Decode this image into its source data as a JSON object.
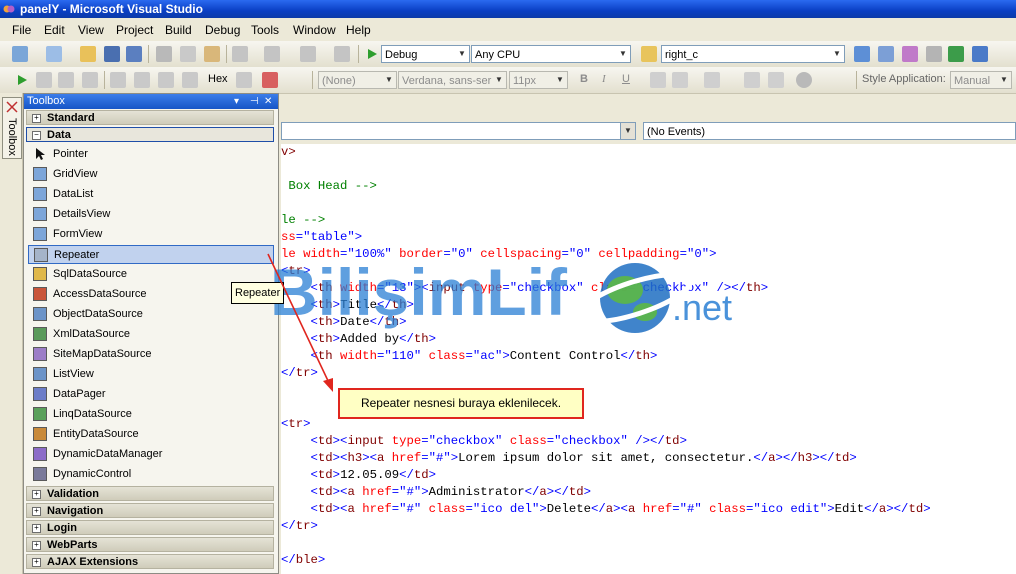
{
  "window": {
    "title": "panelY - Microsoft Visual Studio"
  },
  "menu": {
    "items": [
      "File",
      "Edit",
      "View",
      "Project",
      "Build",
      "Debug",
      "Tools",
      "Window",
      "Help"
    ]
  },
  "toolbar1": {
    "config": "Debug",
    "platform": "Any CPU",
    "find": "right_c"
  },
  "toolbar2": {
    "hex_label": "Hex",
    "style_target": "(None)",
    "font_name": "Verdana, sans-ser",
    "font_size": "11px",
    "bold": "B",
    "italic": "I",
    "underline": "U",
    "style_app_label": "Style Application:",
    "style_app_value": "Manual"
  },
  "side_tab": {
    "label": "Toolbox"
  },
  "toolbox": {
    "title": "Toolbox",
    "categories_top": [
      {
        "label": "Standard",
        "sign": "+"
      },
      {
        "label": "Data",
        "sign": "−"
      }
    ],
    "data_items": [
      "Pointer",
      "GridView",
      "DataList",
      "DetailsView",
      "FormView",
      "Repeater",
      "SqlDataSource",
      "AccessDataSource",
      "ObjectDataSource",
      "XmlDataSource",
      "SiteMapDataSource",
      "ListView",
      "DataPager",
      "LinqDataSource",
      "EntityDataSource",
      "DynamicDataManager",
      "DynamicControl"
    ],
    "categories_bottom": [
      {
        "label": "Validation",
        "sign": "+"
      },
      {
        "label": "Navigation",
        "sign": "+"
      },
      {
        "label": "Login",
        "sign": "+"
      },
      {
        "label": "WebParts",
        "sign": "+"
      },
      {
        "label": "AJAX Extensions",
        "sign": "+"
      }
    ]
  },
  "editor": {
    "events_dropdown": "(No Events)"
  },
  "tooltip": {
    "text": "Repeater"
  },
  "callout": {
    "text": "Repeater nesnesi buraya eklenilecek."
  },
  "watermark": {
    "text_main": "BilişimLif",
    "text_suffix": ".net"
  },
  "code_lines": [
    [
      [
        "cm",
        "v>"
      ]
    ],
    [],
    [
      [
        "cg",
        " Box Head -->"
      ]
    ],
    [],
    [
      [
        "cg",
        "le -->"
      ]
    ],
    [
      [
        "cr",
        "ss"
      ],
      [
        "cb",
        "=\"table\">"
      ]
    ],
    [
      [
        "cr",
        "le width"
      ],
      [
        "cb",
        "=\"100%\" "
      ],
      [
        "cr",
        "border"
      ],
      [
        "cb",
        "=\"0\" "
      ],
      [
        "cr",
        "cellspacing"
      ],
      [
        "cb",
        "=\"0\" "
      ],
      [
        "cr",
        "cellpadding"
      ],
      [
        "cb",
        "=\"0\">"
      ]
    ],
    [
      [
        "cb",
        "<"
      ],
      [
        "cm",
        "tr"
      ],
      [
        "cb",
        ">"
      ]
    ],
    [
      [
        "cb",
        "    <"
      ],
      [
        "cm",
        "th "
      ],
      [
        "cr",
        "width"
      ],
      [
        "cb",
        "=\"13\"><"
      ],
      [
        "cm",
        "input "
      ],
      [
        "cr",
        "type"
      ],
      [
        "cb",
        "=\"checkbox\" "
      ],
      [
        "cr",
        "class"
      ],
      [
        "cb",
        "=\"checkbox\" /></"
      ],
      [
        "cm",
        "th"
      ],
      [
        "cb",
        ">"
      ]
    ],
    [
      [
        "cb",
        "    <"
      ],
      [
        "cm",
        "th"
      ],
      [
        "cb",
        ">"
      ],
      [
        "k",
        "Title"
      ],
      [
        "cb",
        "</"
      ],
      [
        "cm",
        "th"
      ],
      [
        "cb",
        ">"
      ]
    ],
    [
      [
        "cb",
        "    <"
      ],
      [
        "cm",
        "th"
      ],
      [
        "cb",
        ">"
      ],
      [
        "k",
        "Date"
      ],
      [
        "cb",
        "</"
      ],
      [
        "cm",
        "th"
      ],
      [
        "cb",
        ">"
      ]
    ],
    [
      [
        "cb",
        "    <"
      ],
      [
        "cm",
        "th"
      ],
      [
        "cb",
        ">"
      ],
      [
        "k",
        "Added by"
      ],
      [
        "cb",
        "</"
      ],
      [
        "cm",
        "th"
      ],
      [
        "cb",
        ">"
      ]
    ],
    [
      [
        "cb",
        "    <"
      ],
      [
        "cm",
        "th "
      ],
      [
        "cr",
        "width"
      ],
      [
        "cb",
        "=\"110\" "
      ],
      [
        "cr",
        "class"
      ],
      [
        "cb",
        "=\"ac\">"
      ],
      [
        "k",
        "Content Control"
      ],
      [
        "cb",
        "</"
      ],
      [
        "cm",
        "th"
      ],
      [
        "cb",
        ">"
      ]
    ],
    [
      [
        "cb",
        "</"
      ],
      [
        "cm",
        "tr"
      ],
      [
        "cb",
        ">"
      ]
    ],
    [],
    [],
    [
      [
        "cb",
        "<"
      ],
      [
        "cm",
        "tr"
      ],
      [
        "cb",
        ">"
      ]
    ],
    [
      [
        "cb",
        "    <"
      ],
      [
        "cm",
        "td"
      ],
      [
        "cb",
        "><"
      ],
      [
        "cm",
        "input "
      ],
      [
        "cr",
        "type"
      ],
      [
        "cb",
        "=\"checkbox\" "
      ],
      [
        "cr",
        "class"
      ],
      [
        "cb",
        "=\"checkbox\" /></"
      ],
      [
        "cm",
        "td"
      ],
      [
        "cb",
        ">"
      ]
    ],
    [
      [
        "cb",
        "    <"
      ],
      [
        "cm",
        "td"
      ],
      [
        "cb",
        "><"
      ],
      [
        "cm",
        "h3"
      ],
      [
        "cb",
        "><"
      ],
      [
        "cm",
        "a "
      ],
      [
        "cr",
        "href"
      ],
      [
        "cb",
        "=\"#\">"
      ],
      [
        "k",
        "Lorem ipsum dolor sit amet, consectetur."
      ],
      [
        "cb",
        "</"
      ],
      [
        "cm",
        "a"
      ],
      [
        "cb",
        "></"
      ],
      [
        "cm",
        "h3"
      ],
      [
        "cb",
        "></"
      ],
      [
        "cm",
        "td"
      ],
      [
        "cb",
        ">"
      ]
    ],
    [
      [
        "cb",
        "    <"
      ],
      [
        "cm",
        "td"
      ],
      [
        "cb",
        ">"
      ],
      [
        "k",
        "12.05.09"
      ],
      [
        "cb",
        "</"
      ],
      [
        "cm",
        "td"
      ],
      [
        "cb",
        ">"
      ]
    ],
    [
      [
        "cb",
        "    <"
      ],
      [
        "cm",
        "td"
      ],
      [
        "cb",
        "><"
      ],
      [
        "cm",
        "a "
      ],
      [
        "cr",
        "href"
      ],
      [
        "cb",
        "=\"#\">"
      ],
      [
        "k",
        "Administrator"
      ],
      [
        "cb",
        "</"
      ],
      [
        "cm",
        "a"
      ],
      [
        "cb",
        "></"
      ],
      [
        "cm",
        "td"
      ],
      [
        "cb",
        ">"
      ]
    ],
    [
      [
        "cb",
        "    <"
      ],
      [
        "cm",
        "td"
      ],
      [
        "cb",
        "><"
      ],
      [
        "cm",
        "a "
      ],
      [
        "cr",
        "href"
      ],
      [
        "cb",
        "=\"#\" "
      ],
      [
        "cr",
        "class"
      ],
      [
        "cb",
        "=\"ico del\">"
      ],
      [
        "k",
        "Delete"
      ],
      [
        "cb",
        "</"
      ],
      [
        "cm",
        "a"
      ],
      [
        "cb",
        "><"
      ],
      [
        "cm",
        "a "
      ],
      [
        "cr",
        "href"
      ],
      [
        "cb",
        "=\"#\" "
      ],
      [
        "cr",
        "class"
      ],
      [
        "cb",
        "=\"ico edit\">"
      ],
      [
        "k",
        "Edit"
      ],
      [
        "cb",
        "</"
      ],
      [
        "cm",
        "a"
      ],
      [
        "cb",
        "></"
      ],
      [
        "cm",
        "td"
      ],
      [
        "cb",
        ">"
      ]
    ],
    [
      [
        "cb",
        "</"
      ],
      [
        "cm",
        "tr"
      ],
      [
        "cb",
        ">"
      ]
    ],
    [],
    [
      [
        "cb",
        "</"
      ],
      [
        "cm",
        "ble"
      ],
      [
        "cb",
        ">"
      ]
    ]
  ]
}
